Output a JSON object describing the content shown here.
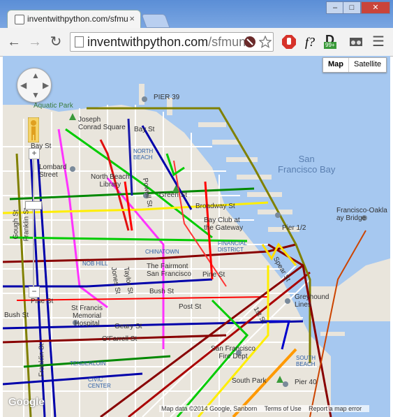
{
  "browser": {
    "tab_title": "inventwithpython.com/sfmun",
    "tab_close": "×",
    "window_buttons": [
      "–",
      "□",
      "✕"
    ],
    "url_host": "inventwithpython.com",
    "url_path": "/sfmuni/",
    "extension_labels": [
      "f?",
      "99+"
    ]
  },
  "map": {
    "type_buttons": [
      "Map",
      "Satellite"
    ],
    "labels": {
      "pier39": "PIER 39",
      "aquatic_park": "Aquatic Park",
      "joseph_conrad_square": "Joseph\nConrad Square",
      "bay_st": "Bay St",
      "north_beach": "NORTH\nBEACH",
      "lombard_street": "Lombard\nStreet",
      "north_beach_library": "North Beach\nLibrary",
      "green_st": "Green St",
      "san_francisco_bay": "San\nFrancisco Bay",
      "broadway_st": "Broadway St",
      "bay_club": "Bay Club at\nthe Gateway",
      "pier_half": "Pier 1/2",
      "chinatown": "CHINATOWN",
      "financial_district": "FINANCIAL\nDISTRICT",
      "nob_hill": "NOB HILL",
      "fairmont": "The Fairmont\nSan Francisco",
      "pine_st": "Pine St",
      "bush_st": "Bush St",
      "post_st": "Post St",
      "st_francis": "St Francis\nMemorial\nHospital",
      "geary_st": "Geary St",
      "ofarrell": "O'Farrell St",
      "tenderloin": "TENDERLOIN",
      "civic_center": "CIVIC\nCENTER",
      "greyhound": "Greyhound\nLines",
      "south_beach": "SOUTH\nBEACH",
      "sf_fire_dept": "San Francisco\nFire Dept",
      "south_park": "South Park",
      "pier40": "Pier 40",
      "oakland_bridge": "Francisco-Oakla\nay Bridge",
      "franklin_st": "Franklin St",
      "gough_st": "Gough St",
      "powell_st": "Powell St",
      "spear_st": "Spear St",
      "first_st": "1st St",
      "jones_st": "Jones St",
      "taylor_st": "Taylor St"
    },
    "footer": [
      "Map data ©2014 Google, Sanborn",
      "Terms of Use",
      "Report a map error"
    ],
    "logo": "Google"
  }
}
